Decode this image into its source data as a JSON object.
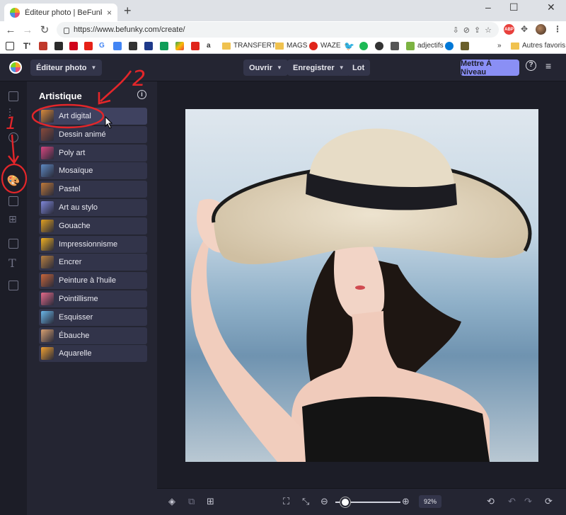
{
  "browser": {
    "tab_title": "Éditeur photo | BeFunky Photo E",
    "tab_close": "×",
    "new_tab": "+",
    "window_controls": [
      "‒",
      "☐",
      "✕"
    ],
    "url": "https://www.befunky.com/create/",
    "abp_label": "ABP",
    "bookmarks": [
      {
        "label": "TRANSFERTS",
        "icon": "folder-icon"
      },
      {
        "label": "MAGS",
        "icon": "folder-icon"
      },
      {
        "label": "WAZE",
        "icon": "waze-icon"
      },
      {
        "label": "adjectifs",
        "icon": "leaf-icon"
      },
      {
        "label": "Autres favoris",
        "icon": "folder-icon"
      }
    ],
    "overflow": "»"
  },
  "app": {
    "mode_label": "Éditeur photo",
    "menu": {
      "open_label": "Ouvrir",
      "save_label": "Enregistrer",
      "batch_label": "Lot"
    },
    "upgrade_label": "Mettre À Niveau",
    "help_icon": "help-circle-icon",
    "menu_icon": "hamburger-menu-icon",
    "rail_icons": [
      "image-icon",
      "sliders-icon",
      "eye-icon",
      "palette-icon",
      "frame-icon",
      "graphics-icon",
      "overlay-icon",
      "text-icon",
      "texture-icon"
    ],
    "rail_active_index": 3
  },
  "panel": {
    "title": "Artistique",
    "active_index": 0,
    "effects": [
      {
        "label": "Art digital",
        "thumb": "#d98a3a"
      },
      {
        "label": "Dessin animé",
        "thumb": "#8a4a3a"
      },
      {
        "label": "Poly art",
        "thumb": "#d8467f"
      },
      {
        "label": "Mosaïque",
        "thumb": "#5e8ac2"
      },
      {
        "label": "Pastel",
        "thumb": "#c07a3a"
      },
      {
        "label": "Art au stylo",
        "thumb": "#7e86d8"
      },
      {
        "label": "Gouache",
        "thumb": "#e0a020"
      },
      {
        "label": "Impressionnisme",
        "thumb": "#f0b020"
      },
      {
        "label": "Encrer",
        "thumb": "#b88040"
      },
      {
        "label": "Peinture à l'huile",
        "thumb": "#c8663a"
      },
      {
        "label": "Pointillisme",
        "thumb": "#e46a8a"
      },
      {
        "label": "Esquisser",
        "thumb": "#6ab6e8"
      },
      {
        "label": "Ébauche",
        "thumb": "#d8a070"
      },
      {
        "label": "Aquarelle",
        "thumb": "#f0a030"
      }
    ]
  },
  "bottombar": {
    "zoom_label": "92%",
    "zoom_level": 0.92
  },
  "annotations": {
    "step1": "1",
    "step2": "2"
  }
}
